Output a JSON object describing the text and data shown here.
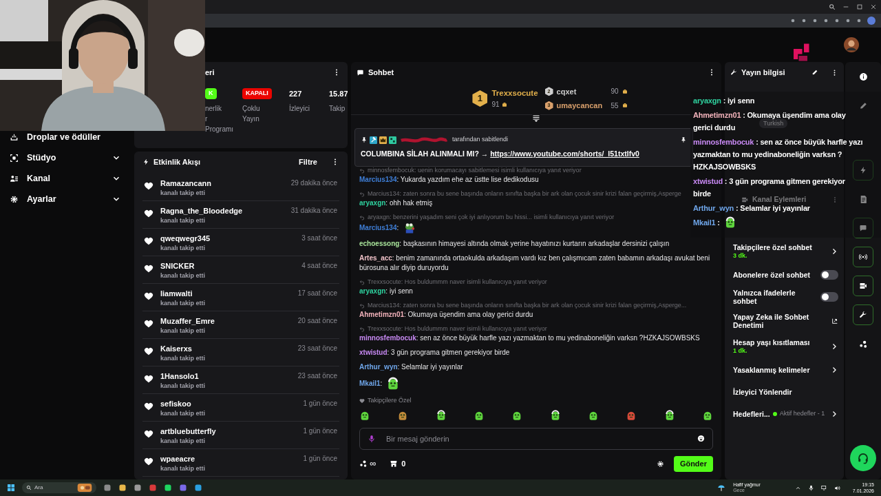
{
  "sidebar": {
    "items": [
      {
        "label": "Droplar ve ödüller",
        "kind": "drops",
        "expandable": false
      },
      {
        "label": "Stüdyo",
        "kind": "studio",
        "expandable": true
      },
      {
        "label": "Kanal",
        "kind": "channel",
        "expandable": true
      },
      {
        "label": "Ayarlar",
        "kind": "settings",
        "expandable": true
      }
    ]
  },
  "stats_card": {
    "title": "eri",
    "stats": [
      {
        "kind": "badge",
        "value": "K",
        "color": "#53fc18",
        "label_lines": [
          "nerlik",
          "r",
          "Programı"
        ]
      },
      {
        "kind": "badge",
        "value": "KAPALI",
        "color": "#eb0400",
        "label_lines": [
          "Çoklu",
          "Yayın"
        ]
      },
      {
        "kind": "number",
        "value": "227",
        "label_lines": [
          "İzleyici"
        ]
      },
      {
        "kind": "number",
        "value": "15.87",
        "label_lines": [
          "Takip"
        ]
      }
    ]
  },
  "activity": {
    "title": "Etkinlik Akışı",
    "filter": "Filtre",
    "events": [
      {
        "user": "Ramazancann",
        "action": "kanalı takip etti",
        "time": "29 dakika önce"
      },
      {
        "user": "Ragna_the_Bloodedge",
        "action": "kanalı takip etti",
        "time": "31 dakika önce"
      },
      {
        "user": "qweqwegr345",
        "action": "kanalı takip etti",
        "time": "3 saat önce"
      },
      {
        "user": "SNICKER",
        "action": "kanalı takip etti",
        "time": "4 saat önce"
      },
      {
        "user": "liamwalti",
        "action": "kanalı takip etti",
        "time": "17 saat önce"
      },
      {
        "user": "Muzaffer_Emre",
        "action": "kanalı takip etti",
        "time": "20 saat önce"
      },
      {
        "user": "Kaiserxs",
        "action": "kanalı takip etti",
        "time": "23 saat önce"
      },
      {
        "user": "1Hansolo1",
        "action": "kanalı takip etti",
        "time": "23 saat önce"
      },
      {
        "user": "sefiskoo",
        "action": "kanalı takip etti",
        "time": "1 gün önce"
      },
      {
        "user": "artbluebutterfly",
        "action": "kanalı takip etti",
        "time": "1 gün önce"
      },
      {
        "user": "wpaeacre",
        "action": "kanalı takip etti",
        "time": "1 gün önce"
      }
    ]
  },
  "chat": {
    "title": "Sohbet",
    "leaderboard": [
      {
        "rank": "1",
        "name": "Trexxsocute",
        "points": "91",
        "color": "#e3b04b"
      },
      {
        "rank": "2",
        "name": "cqxet",
        "points": "90",
        "color": "#cfcfcf"
      },
      {
        "rank": "3",
        "name": "umaycancan",
        "points": "55",
        "color": "#d9a06c"
      }
    ],
    "pinned": {
      "by": "tarafından sabitlendi",
      "text": "COLUMBINA SİLAH ALINMALI MI? → ",
      "link": "https://www.youtube.com/shorts/_I51txtIfv0"
    },
    "messages": [
      {
        "kind": "text",
        "reply": "minnosfembocuk: uenin korumacayı sabitlemesi isimli kullanıcıya yanıt veriyor",
        "user": "Marcius134",
        "color": "#3f7fd8",
        "text": ": Yukarda yazdım ehe az üstte lise dedikodusu"
      },
      {
        "kind": "text",
        "reply": "Marcius134: zaten sonra bu sene başında onların sınıfta başka bir ark olan çocuk sinir krizi falan geçirmiş,Asperge",
        "user": "aryaxgn",
        "color": "#2fd3a0",
        "text": ": ohh hak etmiş"
      },
      {
        "kind": "emote",
        "reply": "aryaxgn: benzerini yaşadım seni çok iyi anlıyorum bu hissi... isimli kullanıcıya yanıt veriyor",
        "user": "Marcius134",
        "color": "#3f7fd8",
        "text": ":"
      },
      {
        "kind": "text",
        "user": "echoessong",
        "color": "#a8e39a",
        "text": ": başkasının himayesi altında olmak yerine hayatınızı kurtarın arkadaşlar dersinizi çalışın"
      },
      {
        "kind": "text",
        "user": "Artes_acc",
        "color": "#f0c2c8",
        "text": ": benim zamanında ortaokulda arkadaşım vardı kız ben çalışmıcam zaten babamın arkadaşı avukat beni bürosuna alır diyip duruyordu"
      },
      {
        "kind": "text",
        "reply": "Trexxsocute: Hos buldummm naver isimli kullanıcıya yanıt veriyor",
        "user": "aryaxgn",
        "color": "#2fd3a0",
        "text": ": iyi senn"
      },
      {
        "kind": "text",
        "reply": "Marcius134: zaten sonra bu sene başında onların sınıfta başka bir ark olan çocuk sinir krizi falan geçirmiş,Asperge...",
        "user": "Ahmetimzn01",
        "color": "#f3b3bb",
        "text": ": Okumaya üşendim ama olay gerici durdu"
      },
      {
        "kind": "text",
        "reply": "Trexxsocute: Hos buldummm naver isimli kullanıcıya yanıt veriyor",
        "user": "minnosfembocuk",
        "color": "#c98af5",
        "text": ": sen az önce büyük harfle yazı yazmaktan to mu yedinaboneliğin varksn ?HZKAJSOWBSKS"
      },
      {
        "kind": "text",
        "user": "xtwistud",
        "color": "#c98af5",
        "text": ": 3 gün programa gitmen gerekiyor birde"
      },
      {
        "kind": "text",
        "user": "Arthur_wyn",
        "color": "#6fa6ea",
        "text": ": Selamlar iyi yayınlar"
      },
      {
        "kind": "emote",
        "user": "Mkail1",
        "color": "#6fa6ea",
        "text": ":"
      }
    ],
    "emote_section": "Takipçilere Özel",
    "placeholder": "Bir mesaj gönderin",
    "points": "∞",
    "store_count": "0",
    "send": "Gönder"
  },
  "overlay_chat": {
    "messages": [
      {
        "kind": "text",
        "user": "aryaxgn",
        "color": "#2fd3a0",
        "lines": [
          " : iyi senn"
        ]
      },
      {
        "kind": "text",
        "user": "Ahmetimzn01",
        "color": "#f3b3bb",
        "lines": [
          " : Okumaya üşendim ama olay",
          "gerici durdu"
        ]
      },
      {
        "kind": "text",
        "user": "minnosfembocuk",
        "color": "#c98af5",
        "lines": [
          " : sen az önce büyük harfle yazı",
          "yazmaktan to mu yedinaboneliğin varksn ?",
          "HZKAJSOWBSKS"
        ]
      },
      {
        "kind": "text",
        "user": "xtwistud",
        "color": "#c98af5",
        "lines": [
          " : 3 gün programa gitmen gerekiyor",
          "birde"
        ]
      },
      {
        "kind": "text",
        "user": "Arthur_wyn",
        "color": "#6fa6ea",
        "lines": [
          " : Selamlar iyi yayınlar"
        ]
      },
      {
        "kind": "emote",
        "user": "Mkail1",
        "color": "#6fa6ea",
        "lines": [
          " :"
        ]
      }
    ]
  },
  "stream_info": {
    "title": "Yayın bilgisi",
    "tag": "Turkish",
    "actions_title": "Kanal Eylemleri",
    "actions": [
      {
        "kind": "link",
        "label": "Takipçilere özel sohbet",
        "value": "3 dk."
      },
      {
        "kind": "toggle",
        "label": "Abonelere özel sohbet",
        "on": false
      },
      {
        "kind": "toggle",
        "label": "Yalnızca ifadelerle sohbet",
        "on": false
      },
      {
        "kind": "external",
        "label": "Yapay Zeka ile Sohbet Denetimi"
      },
      {
        "kind": "link",
        "label": "Hesap yaşı kısıtlaması",
        "value": "1 dk."
      },
      {
        "kind": "link",
        "label": "Yasaklanmış kelimeler"
      },
      {
        "kind": "plain",
        "label": "İzleyici Yönlendir"
      },
      {
        "kind": "status",
        "label": "Hedefleri...",
        "status": "Aktif hedefler - 1"
      }
    ]
  },
  "taskbar": {
    "search": "Ara",
    "weather": "Hafif yağmur",
    "weather_sub": "Gece",
    "time": "19:15",
    "date": "7.01.2026"
  }
}
